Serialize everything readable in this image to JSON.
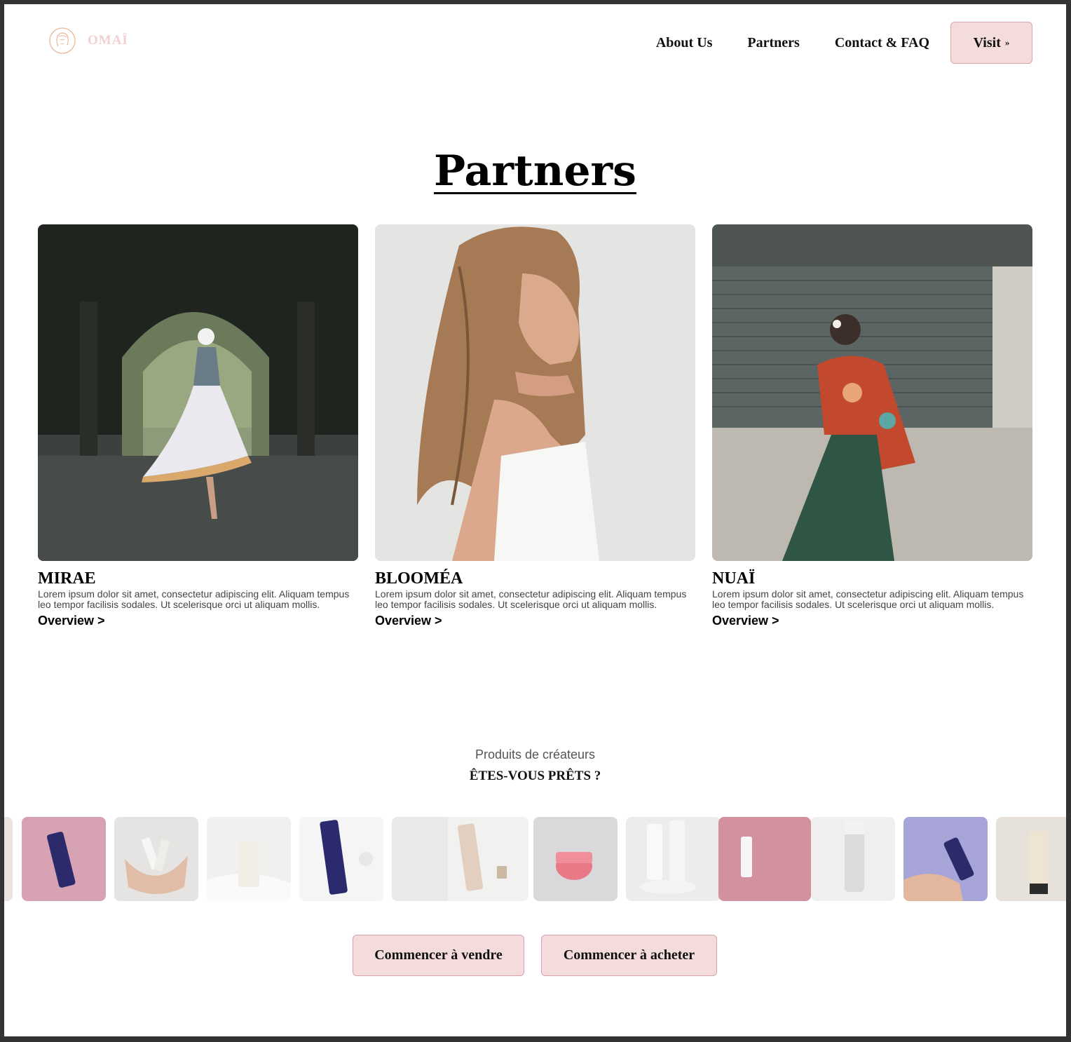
{
  "brand": {
    "name": "OMAÏ"
  },
  "nav": {
    "links": [
      "About Us",
      "Partners",
      "Contact & FAQ"
    ],
    "visit_label": "Visit",
    "visit_arrow": "»"
  },
  "page": {
    "title": "Partners"
  },
  "partners": [
    {
      "name": "MIRAE",
      "description": "Lorem ipsum dolor sit amet, consectetur adipiscing elit. Aliquam tempus leo tempor facilisis sodales. Ut scelerisque orci ut aliquam mollis.",
      "link": "Overview >"
    },
    {
      "name": "BLOOMÉA",
      "description": "Lorem ipsum dolor sit amet, consectetur adipiscing elit. Aliquam tempus leo tempor facilisis sodales. Ut scelerisque orci ut aliquam mollis.",
      "link": "Overview >"
    },
    {
      "name": "NUAÏ",
      "description": "Lorem ipsum dolor sit amet, consectetur adipiscing elit. Aliquam tempus leo tempor facilisis sodales. Ut scelerisque orci ut aliquam mollis.",
      "link": "Overview >"
    }
  ],
  "products": {
    "subtitle": "Produits de créateurs",
    "headline": "ÊTES-VOUS PRÊTS ?"
  },
  "cta": {
    "sell": "Commencer à vendre",
    "buy": "Commencer à acheter"
  },
  "colors": {
    "accent_bg": "#f4dcdc",
    "accent_border": "#d6a2ab",
    "logo": "#f2cfd1"
  }
}
